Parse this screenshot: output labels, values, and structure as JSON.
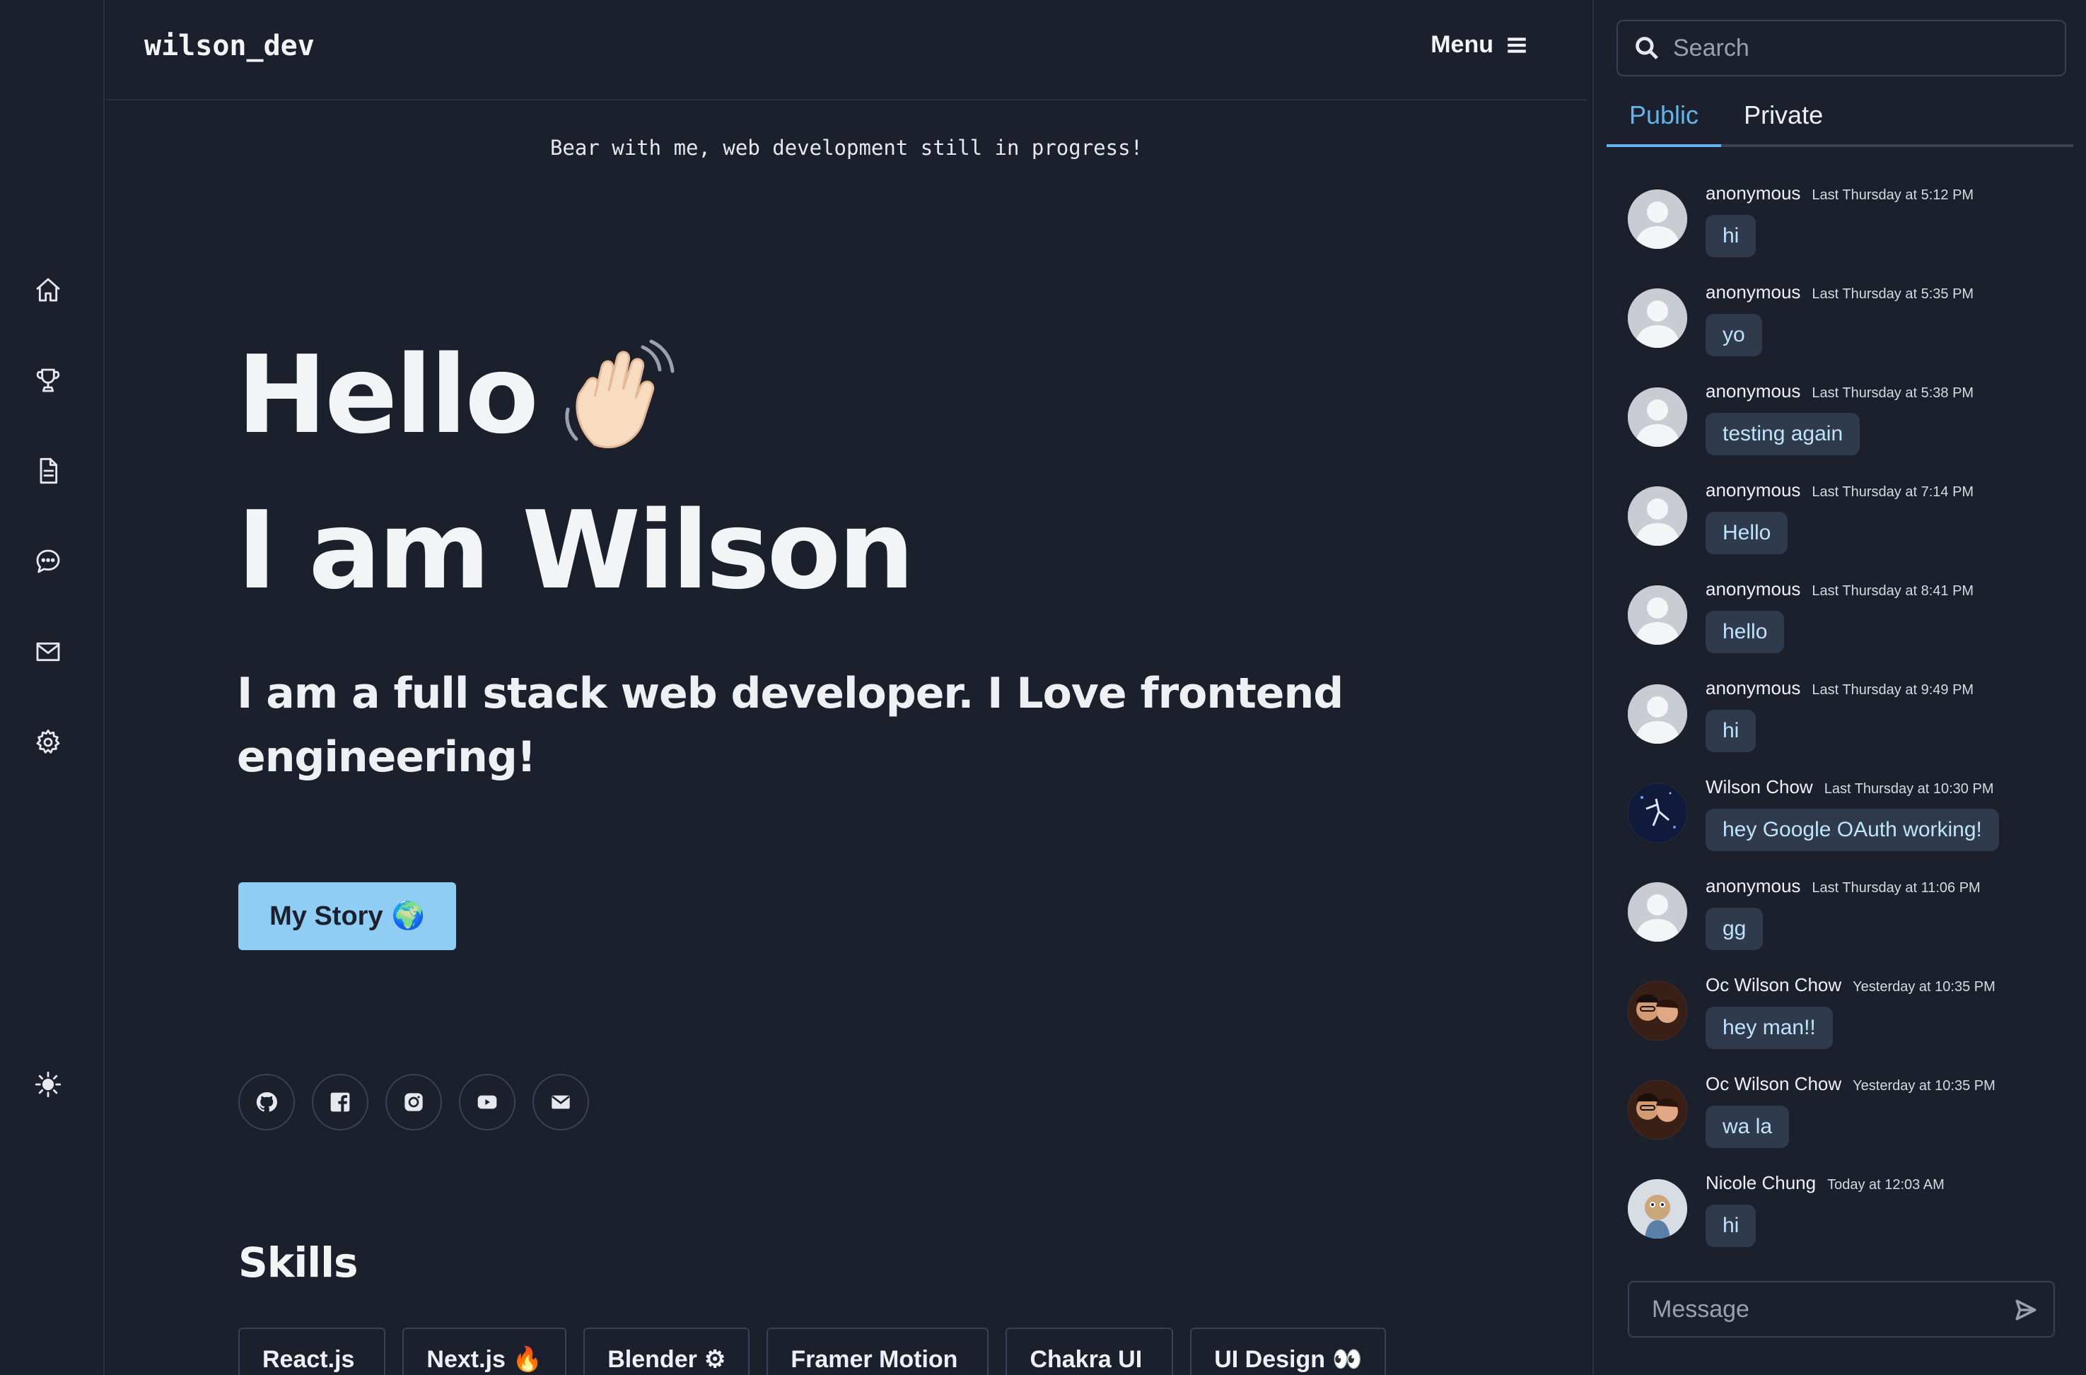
{
  "brand": "wilson_dev",
  "menu_label": "Menu",
  "notice": "Bear with me, web development still in progress!",
  "hero": {
    "hello": "Hello",
    "iam": "I am Wilson",
    "tagline": "I am a full stack web developer. I Love frontend engineering!",
    "cta": "My Story",
    "cta_emoji": "🌍"
  },
  "sidebar": {
    "icons": [
      "home-icon",
      "trophy-icon",
      "document-icon",
      "chat-icon",
      "mail-icon",
      "settings-icon",
      "theme-toggle-icon"
    ]
  },
  "socials": [
    "github-icon",
    "facebook-icon",
    "instagram-icon",
    "youtube-icon",
    "mail-icon"
  ],
  "skills_title": "Skills",
  "skills": [
    {
      "label": "React.js",
      "emoji": ""
    },
    {
      "label": "Next.js",
      "emoji": "🔥"
    },
    {
      "label": "Blender",
      "emoji": "⚙"
    },
    {
      "label": "Framer Motion",
      "emoji": ""
    },
    {
      "label": "Chakra UI",
      "emoji": ""
    },
    {
      "label": "UI Design",
      "emoji": "👀"
    }
  ],
  "chat": {
    "search_placeholder": "Search",
    "tabs": [
      "Public",
      "Private"
    ],
    "active_tab": "Public",
    "message_placeholder": "Message",
    "messages": [
      {
        "user": "anonymous",
        "time": "Last Thursday at 5:12 PM",
        "text": "hi"
      },
      {
        "user": "anonymous",
        "time": "Last Thursday at 5:35 PM",
        "text": "yo"
      },
      {
        "user": "anonymous",
        "time": "Last Thursday at 5:38 PM",
        "text": "testing again"
      },
      {
        "user": "anonymous",
        "time": "Last Thursday at 7:14 PM",
        "text": "Hello"
      },
      {
        "user": "anonymous",
        "time": "Last Thursday at 8:41 PM",
        "text": "hello"
      },
      {
        "user": "anonymous",
        "time": "Last Thursday at 9:49 PM",
        "text": "hi"
      },
      {
        "user": "Wilson Chow",
        "time": "Last Thursday at 10:30 PM",
        "text": "hey Google OAuth working!"
      },
      {
        "user": "anonymous",
        "time": "Last Thursday at 11:06 PM",
        "text": "gg"
      },
      {
        "user": "Oc Wilson Chow",
        "time": "Yesterday at 10:35 PM",
        "text": "hey man!!"
      },
      {
        "user": "Oc Wilson Chow",
        "time": "Yesterday at 10:35 PM",
        "text": "wa la"
      },
      {
        "user": "Nicole Chung",
        "time": "Today at 12:03 AM",
        "text": "hi"
      }
    ]
  },
  "colors": {
    "background": "#1b202c",
    "accent": "#63b3ed",
    "button": "#90cdf4",
    "bubble": "#2f3a4c"
  }
}
